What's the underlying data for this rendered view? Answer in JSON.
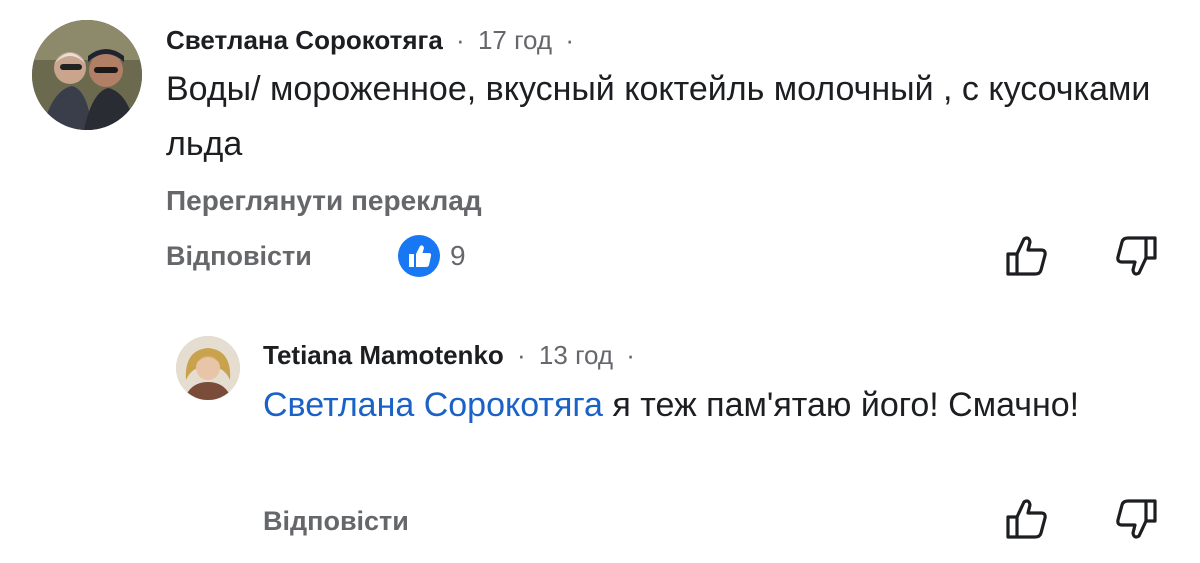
{
  "comment": {
    "author": "Светлана Сорокотяга",
    "dot1": "·",
    "time": "17 год",
    "dot2": "·",
    "text": "Воды/ мороженное, вкусный коктейль молочный , с кусочками льда",
    "see_translation": "Переглянути переклад",
    "reply_label": "Відповісти",
    "like_count": "9"
  },
  "reply": {
    "author": "Tetiana Mamotenko",
    "dot1": "·",
    "time": "13 год",
    "dot2": "·",
    "mention": "Светлана Сорокотяга",
    "text": " я теж пам'ятаю його! Смачно!",
    "reply_label": "Відповісти"
  },
  "colors": {
    "like_badge": "#1877f2",
    "mention": "#1a62c7",
    "secondary_text": "#65676b"
  },
  "icons": {
    "like_badge": "thumbs-up-filled-icon",
    "like": "thumbs-up-outline-icon",
    "dislike": "thumbs-down-outline-icon"
  }
}
